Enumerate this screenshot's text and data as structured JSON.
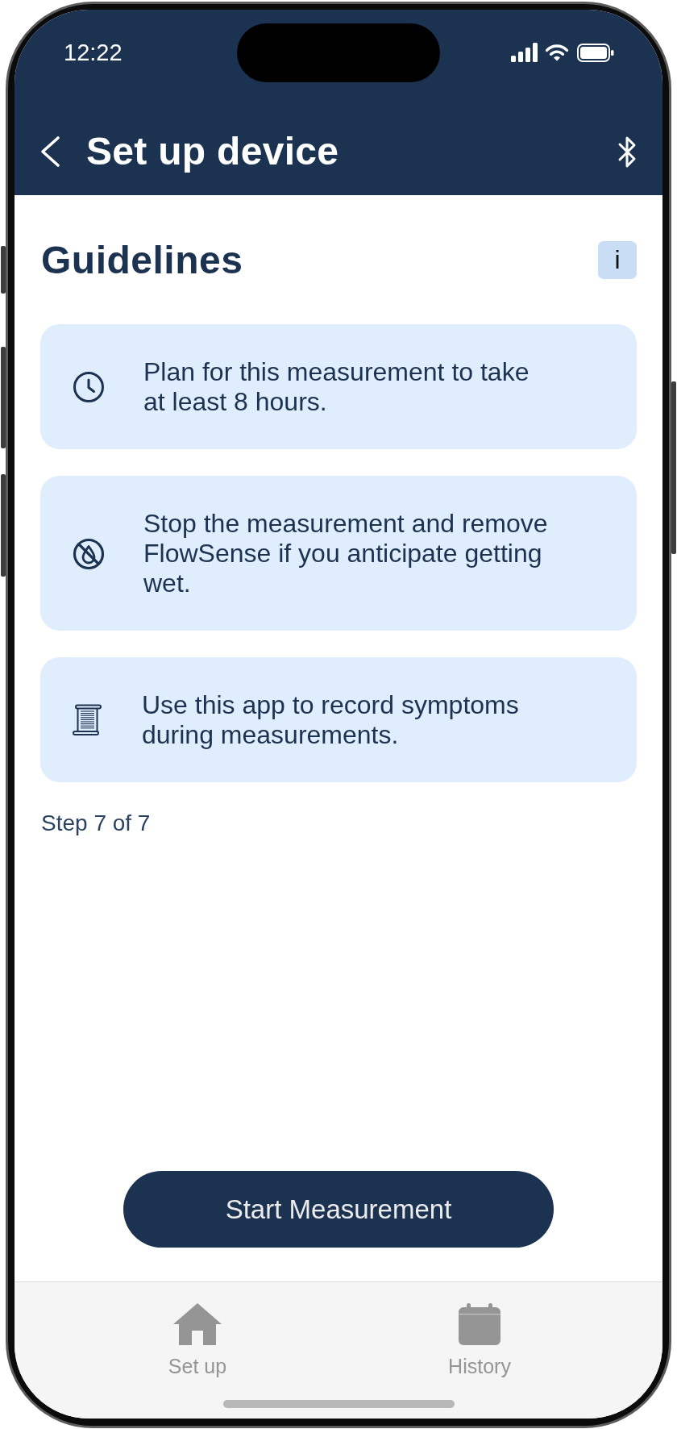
{
  "status_bar": {
    "time": "12:22"
  },
  "app_bar": {
    "title": "Set up device"
  },
  "section": {
    "title": "Guidelines",
    "info_button": "i"
  },
  "guidelines": [
    {
      "text": "Plan for this measurement to take at least 8 hours."
    },
    {
      "text": "Stop the measurement and remove FlowSense if you anticipate getting wet."
    },
    {
      "text": "Use this app to record symptoms during measurements."
    }
  ],
  "step_indicator": "Step 7 of 7",
  "primary_button": "Start Measurement",
  "tab_bar": [
    {
      "label": "Set up"
    },
    {
      "label": "History"
    }
  ]
}
